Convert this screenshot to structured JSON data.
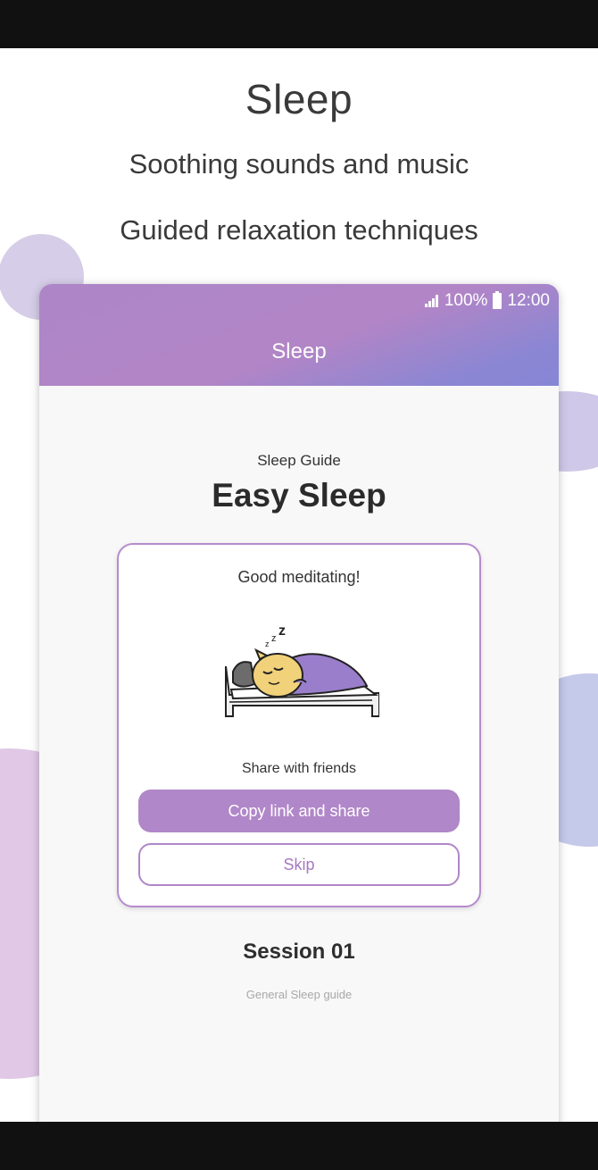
{
  "marketing": {
    "title": "Sleep",
    "subtitle_1": "Soothing sounds and music",
    "subtitle_2": "Guided relaxation techniques"
  },
  "status_bar": {
    "battery": "100%",
    "time": "12:00"
  },
  "app_bar": {
    "title": "Sleep"
  },
  "guide": {
    "label": "Sleep Guide",
    "title": "Easy Sleep"
  },
  "card": {
    "message": "Good meditating!",
    "share_label": "Share with friends",
    "primary_button": "Copy link and share",
    "secondary_button": "Skip"
  },
  "session": {
    "title": "Session 01",
    "subtitle": "General Sleep guide"
  },
  "colors": {
    "accent": "#b087c8",
    "gradient_end": "#8686d6"
  },
  "icons": [
    "signal-icon",
    "battery-icon",
    "sleeping-illustration"
  ]
}
